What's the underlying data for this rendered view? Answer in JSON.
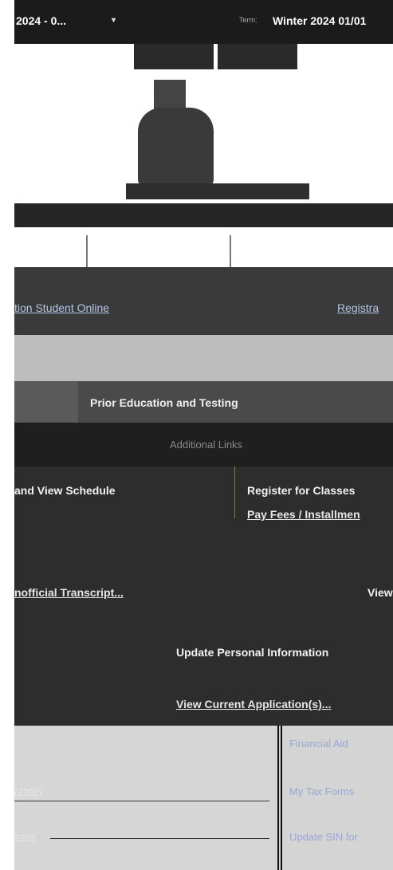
{
  "header": {
    "term_select_value": "2024 - 0...",
    "term_select_chevron": "▾",
    "term_label": "Term:",
    "term_current": "Winter 2024 01/01"
  },
  "links": {
    "student_online": "tion Student Online",
    "registrar": "Registra"
  },
  "section": {
    "prior_education": "Prior Education and Testing",
    "additional_links": "Additional Links"
  },
  "nav": {
    "view_schedule": "and View Schedule",
    "register_classes": "Register for Classes",
    "pay_fees": "Pay Fees / Installmen",
    "unofficial_transcript": "nofficial Transcript...",
    "view_u": "View U",
    "update_personal": "Update Personal Information",
    "view_current_app": "View Current Application(s)..."
  },
  "bottom": {
    "financial_aid": "Financial Aid",
    "my_tax_forms": "My Tax Forms",
    "update_sin": "Update SIN for",
    "date1": "(2202)",
    "date2": "2202"
  }
}
